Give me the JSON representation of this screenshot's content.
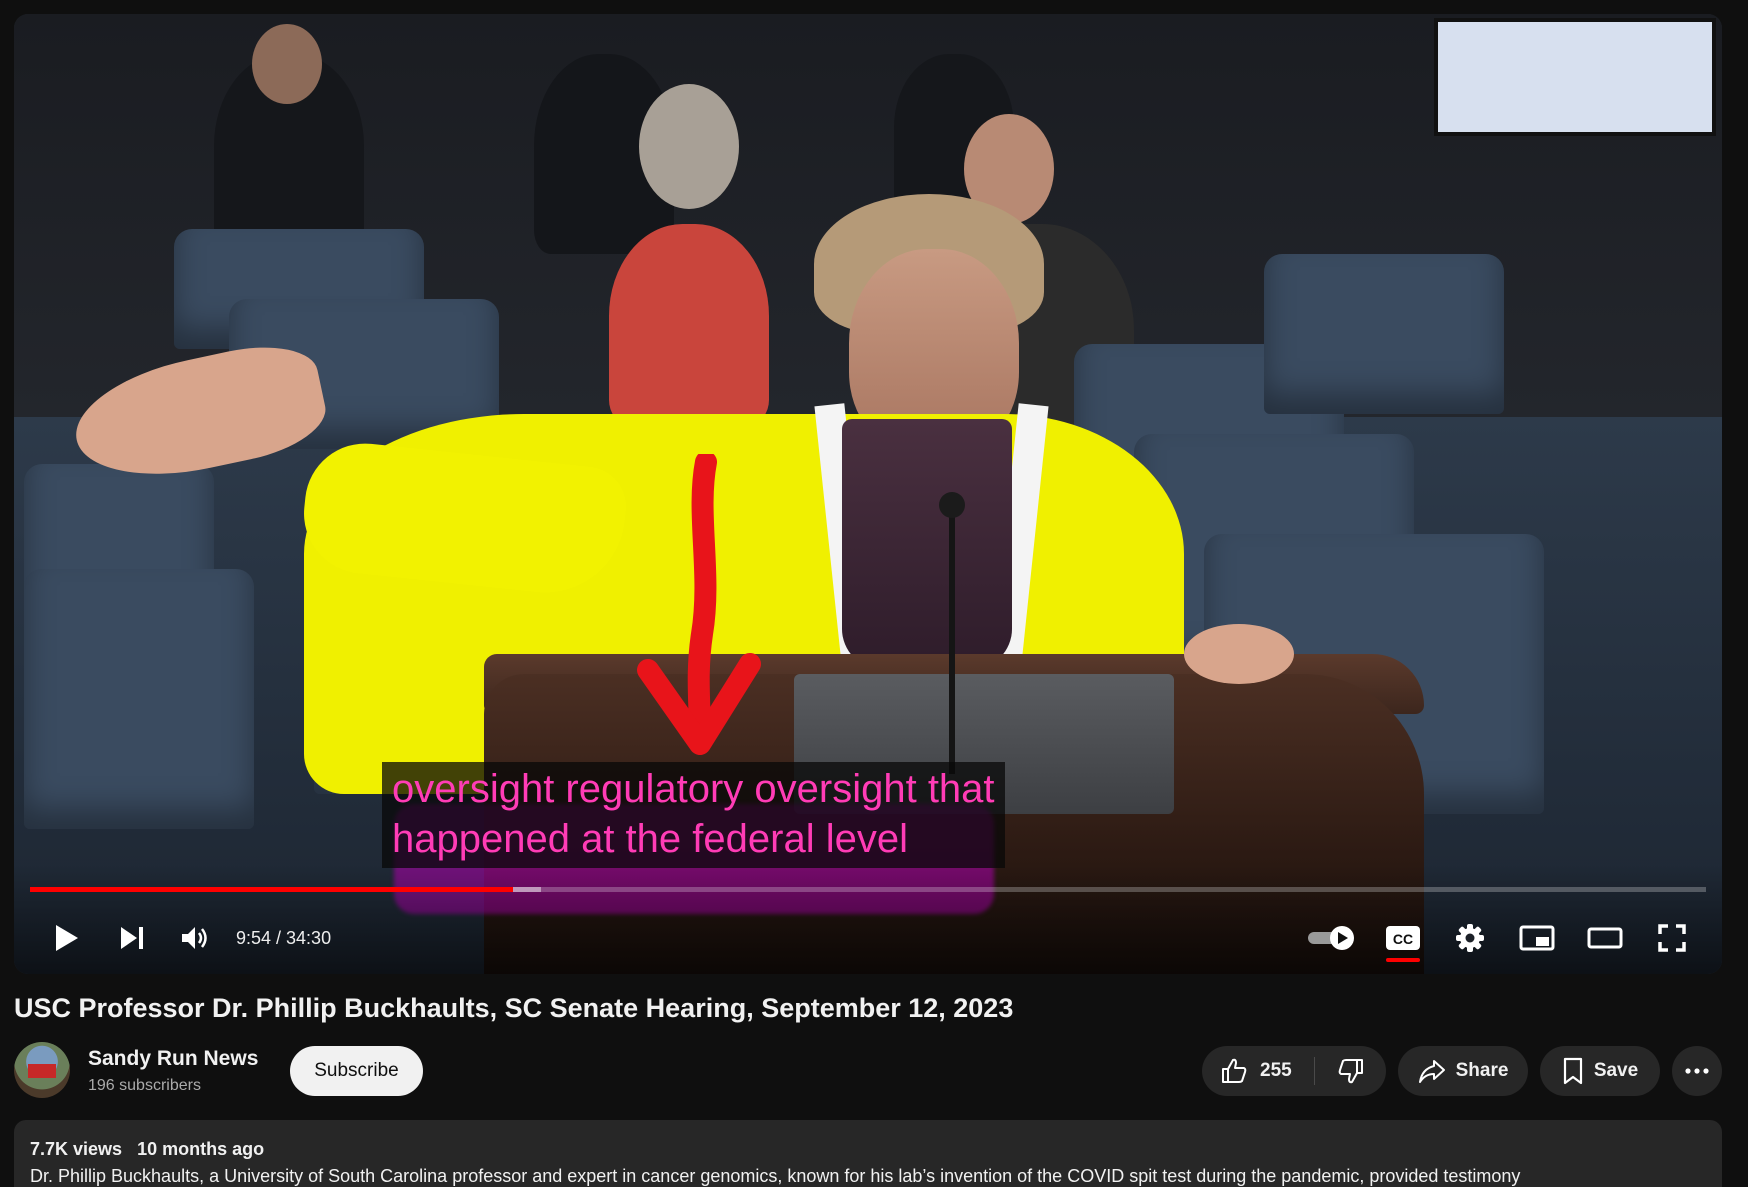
{
  "video": {
    "caption_lines": [
      "oversight regulatory oversight that",
      "happened at the federal level"
    ],
    "progress": {
      "played_fraction": 0.288,
      "buffered_fraction": 0.305
    },
    "time_display": "9:54 / 34:30",
    "controls": {
      "play_icon": "play-icon",
      "next_icon": "next-icon",
      "volume_icon": "volume-icon",
      "autoplay_icon": "autoplay-toggle-icon",
      "cc_icon": "cc-icon",
      "settings_icon": "gear-icon",
      "miniplayer_icon": "miniplayer-icon",
      "theater_icon": "theater-icon",
      "fullscreen_icon": "fullscreen-icon"
    },
    "colors": {
      "progress": "#ff0000",
      "caption_text": "#ff3cb6",
      "annotation_jacket": "#f0f000",
      "annotation_arrow": "#e8141a"
    }
  },
  "title": "USC Professor Dr. Phillip Buckhaults, SC Senate Hearing, September 12, 2023",
  "channel": {
    "name": "Sandy Run News",
    "subscribers": "196 subscribers",
    "subscribe_label": "Subscribe"
  },
  "actions": {
    "like_count": "255",
    "share_label": "Share",
    "save_label": "Save"
  },
  "description": {
    "views": "7.7K views",
    "age": "10 months ago",
    "text": "Dr. Phillip Buckhaults, a University of South Carolina professor and expert in cancer genomics, known for his lab’s invention of the COVID spit test during the pandemic, provided testimony"
  }
}
